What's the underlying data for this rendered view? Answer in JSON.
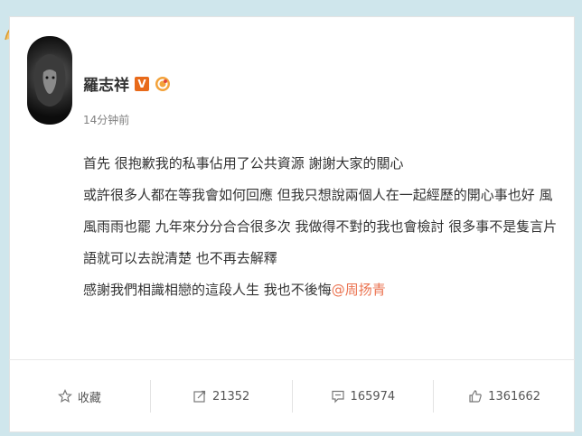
{
  "post": {
    "author": "羅志祥",
    "verified_badge": "V",
    "time": "14分钟前",
    "paragraphs": [
      "首先 很抱歉我的私事佔用了公共資源 謝謝大家的關心",
      "或許很多人都在等我會如何回應 但我只想說兩個人在一起經歷的開心事也好 風風雨雨也罷 九年來分分合合很多次 我做得不對的我也會檢討 很多事不是隻言片語就可以去說清楚 也不再去解釋"
    ],
    "last_line": "感謝我們相識相戀的這段人生 我也不後悔",
    "mention": "@周扬青"
  },
  "actions": {
    "favorite_label": "收藏",
    "repost_count": "21352",
    "comment_count": "165974",
    "like_count": "1361662"
  },
  "colors": {
    "page_bg": "#cfe6ec",
    "mention": "#eb7350",
    "verified": "#e86a1a"
  },
  "icons": [
    "avatar-lion",
    "verified-v-icon",
    "ring-badge-icon",
    "star-icon",
    "repost-icon",
    "comment-icon",
    "thumbs-up-icon"
  ]
}
